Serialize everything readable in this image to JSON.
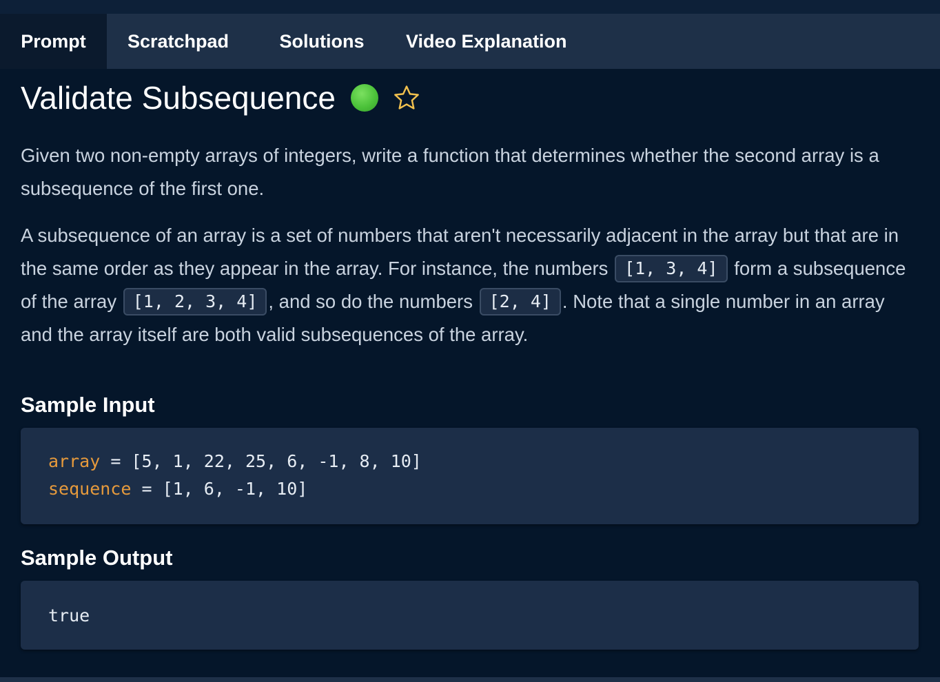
{
  "tabs": {
    "prompt": "Prompt",
    "scratchpad": "Scratchpad",
    "solutions": "Solutions",
    "video": "Video Explanation",
    "active": "Prompt"
  },
  "problem": {
    "title": "Validate Subsequence",
    "difficulty_color": "#4cc23a",
    "favorite_icon": "star-outline-icon"
  },
  "description": {
    "p1": "Given two non-empty arrays of integers, write a function that determines whether the second array is a subsequence of the first one.",
    "p2_part1": "A subsequence of an array is a set of numbers that aren't necessarily adjacent in the array but that are in the same order as they appear in the array. For instance, the numbers",
    "p2_code1": "[1, 3, 4]",
    "p2_part2": "form a subsequence of the array",
    "p2_code2": "[1, 2, 3, 4]",
    "p2_part3": ", and so do the numbers",
    "p2_code3": "[2, 4]",
    "p2_part4": ". Note that a single number in an array and the array itself are both valid subsequences of the array."
  },
  "sample_input": {
    "heading": "Sample Input",
    "line1_var": "array",
    "line1_rest": " = [5, 1, 22, 25, 6, -1, 8, 10]",
    "line2_var": "sequence",
    "line2_rest": " = [1, 6, -1, 10]"
  },
  "sample_output": {
    "heading": "Sample Output",
    "value": "true"
  },
  "colors": {
    "background": "#05162a",
    "tabbar": "#1e3048",
    "active_tab": "#0b1a2d",
    "code_block": "#1c2e48",
    "variable": "#e69a3c",
    "text_muted": "#c9d3df"
  }
}
